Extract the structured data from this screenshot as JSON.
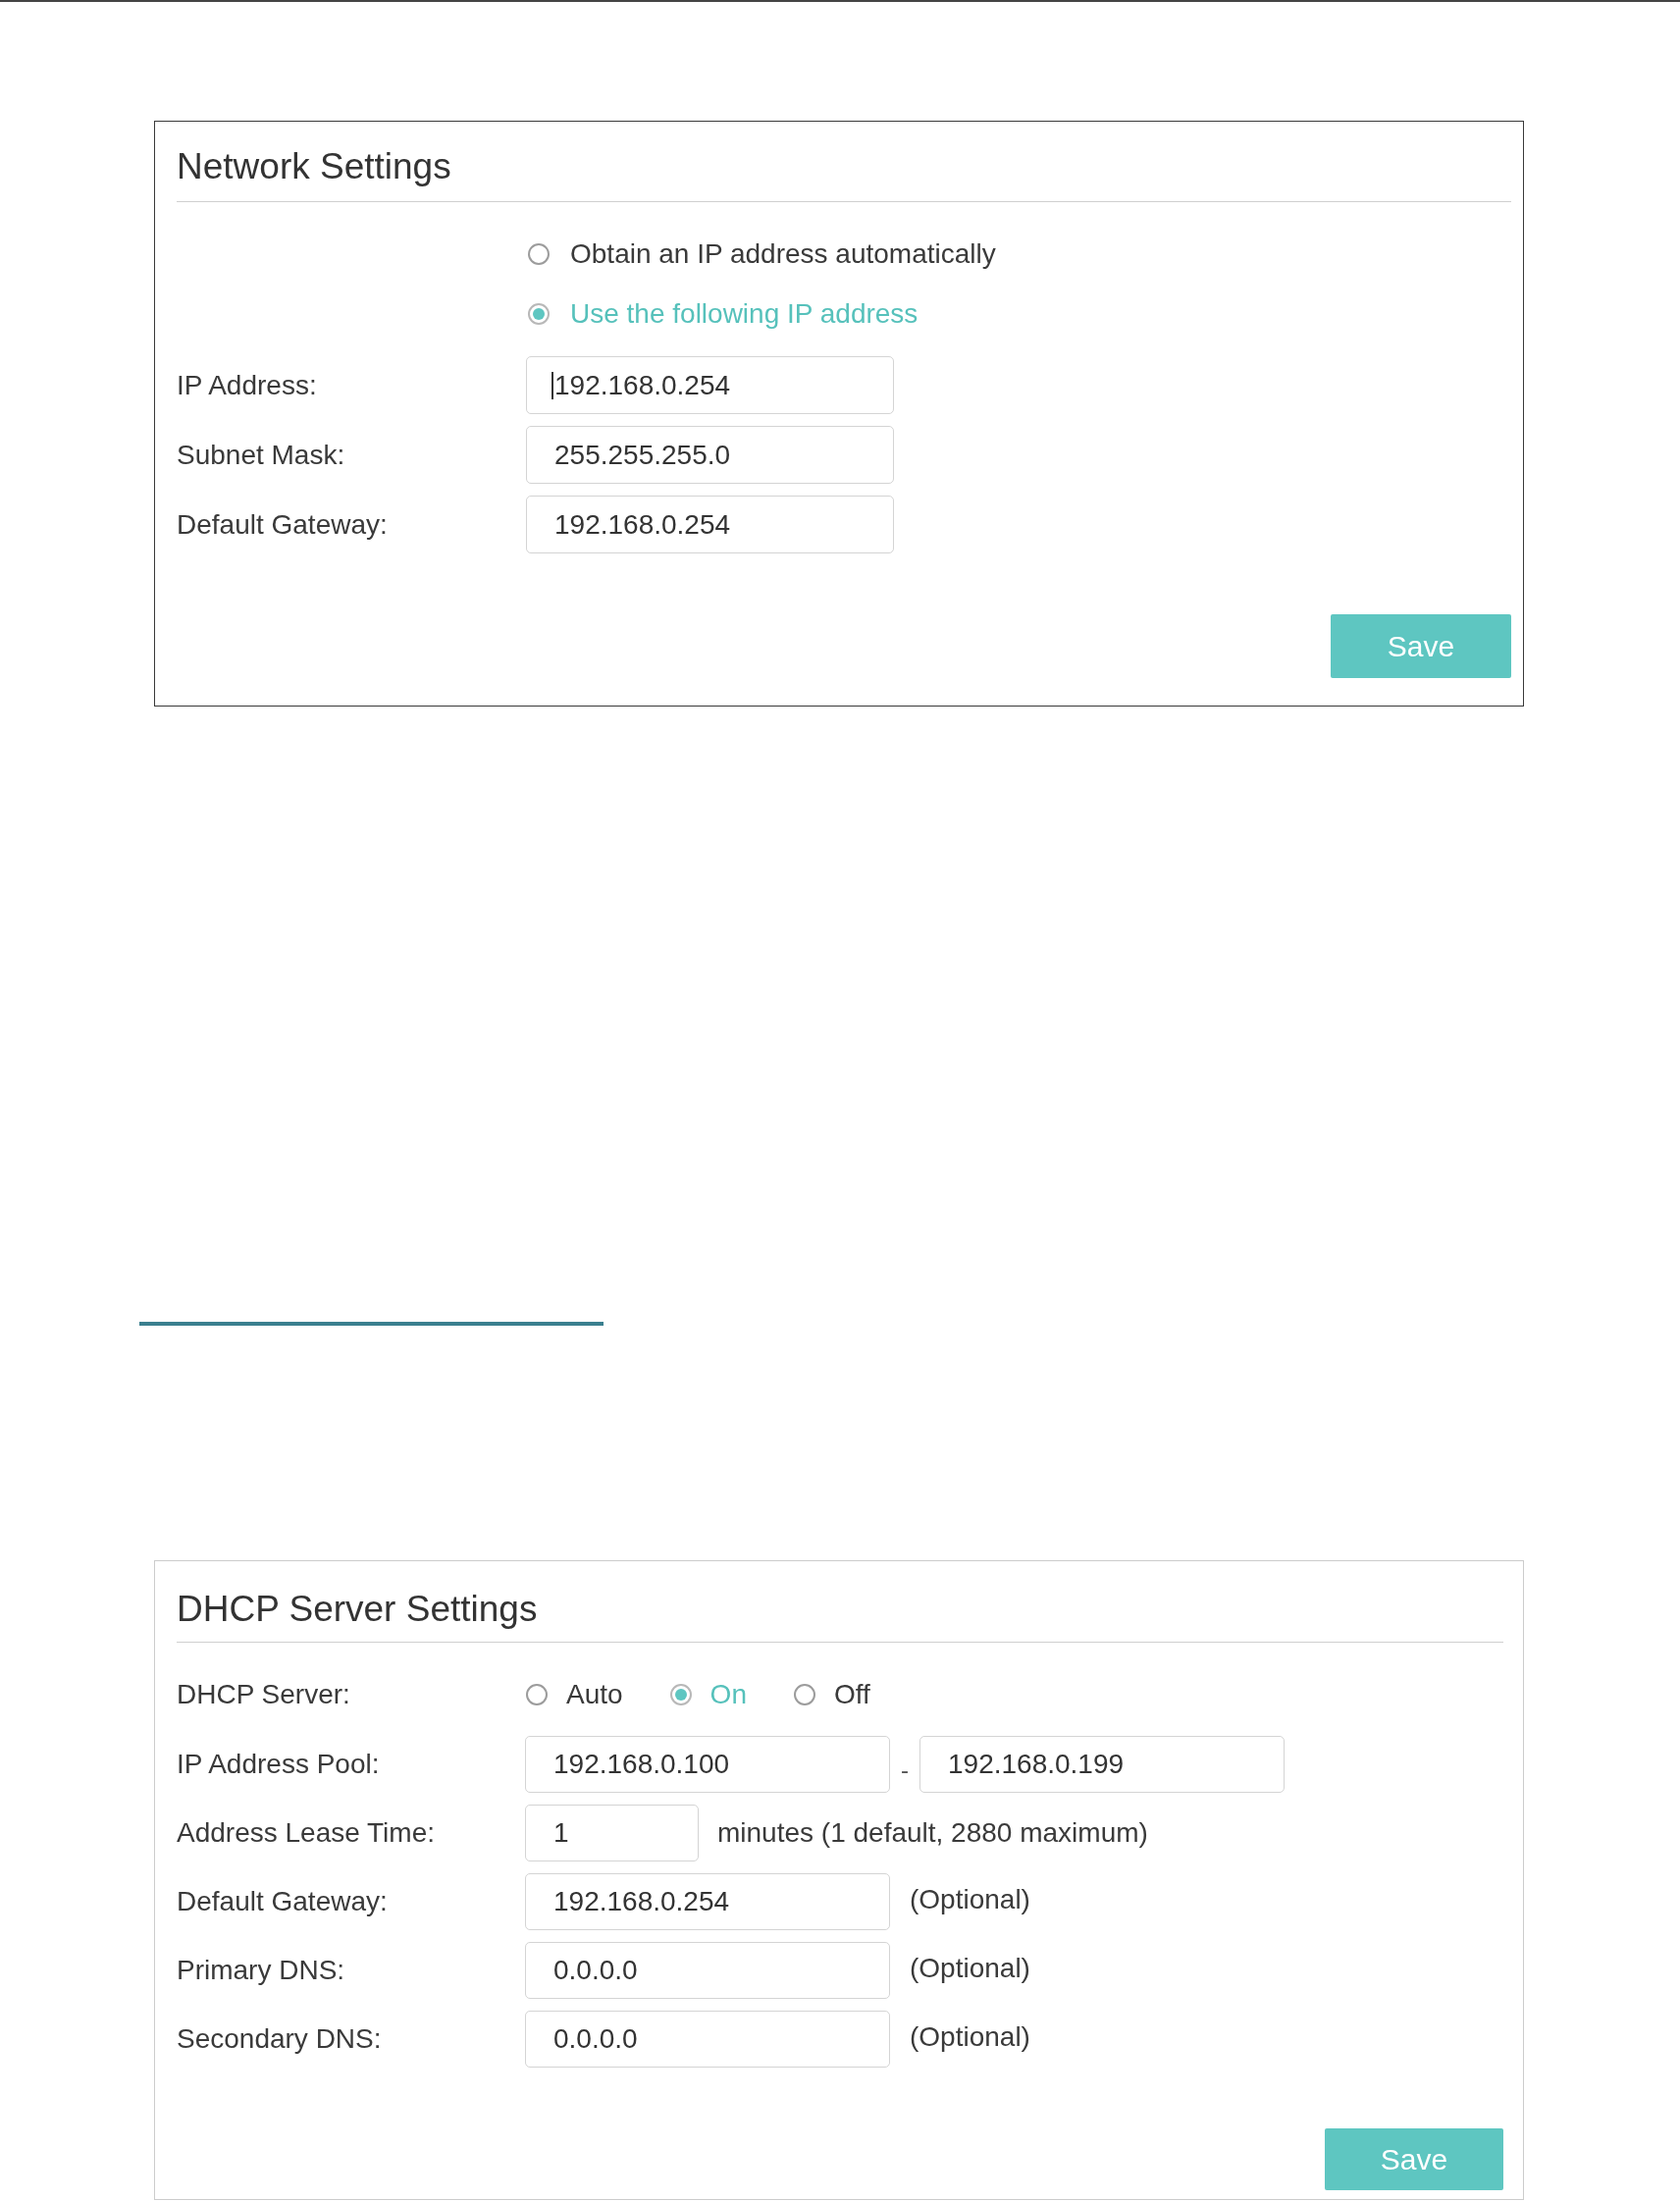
{
  "network_settings": {
    "title": "Network Settings",
    "ip_mode": [
      {
        "label": "Obtain an IP address automatically",
        "selected": false
      },
      {
        "label": "Use the following IP address",
        "selected": true
      }
    ],
    "fields": [
      {
        "label": "IP Address:",
        "value": "192.168.0.254",
        "focused": true
      },
      {
        "label": "Subnet Mask:",
        "value": "255.255.255.0",
        "focused": false
      },
      {
        "label": "Default Gateway:",
        "value": "192.168.0.254",
        "focused": false
      }
    ],
    "save_button": "Save"
  },
  "dhcp_server_settings": {
    "title": "DHCP Server Settings",
    "dhcp_server": {
      "label": "DHCP Server:",
      "options": [
        {
          "label": "Auto",
          "selected": false
        },
        {
          "label": "On",
          "selected": true
        },
        {
          "label": "Off",
          "selected": false
        }
      ]
    },
    "rows": [
      {
        "kind": "range",
        "label": "IP Address Pool:",
        "start": "192.168.0.100",
        "separator": "-",
        "end": "192.168.0.199"
      },
      {
        "kind": "number",
        "label": "Address Lease Time:",
        "value": "1",
        "note": "minutes (1 default, 2880 maximum)"
      },
      {
        "kind": "text",
        "label": "Default Gateway:",
        "value": "192.168.0.254",
        "note": "(Optional)"
      },
      {
        "kind": "text",
        "label": "Primary DNS:",
        "value": "0.0.0.0",
        "note": "(Optional)"
      },
      {
        "kind": "text",
        "label": "Secondary DNS:",
        "value": "0.0.0.0",
        "note": "(Optional)"
      }
    ],
    "save_button": "Save"
  }
}
